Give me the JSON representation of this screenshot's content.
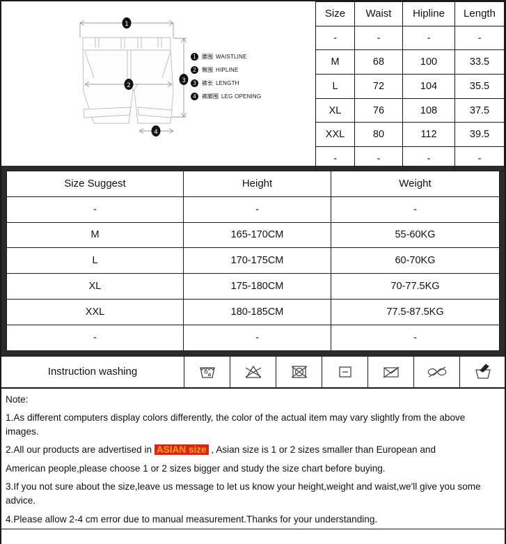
{
  "diagram": {
    "alt": "mens shorts technical drawing with measurement arrows",
    "markers": [
      "1",
      "2",
      "3",
      "4"
    ],
    "legend": [
      {
        "num": "1",
        "cn": "腰围",
        "en": "WAISTLINE"
      },
      {
        "num": "2",
        "cn": "臀围",
        "en": "HIPLINE"
      },
      {
        "num": "3",
        "cn": "裤长",
        "en": "LENGTH"
      },
      {
        "num": "4",
        "cn": "裤脚围",
        "en": "LEG OPENING"
      }
    ]
  },
  "size_table": {
    "headers": [
      "Size",
      "Waist",
      "Hipline",
      "Length"
    ],
    "rows": [
      [
        "-",
        "-",
        "-",
        "-"
      ],
      [
        "M",
        "68",
        "100",
        "33.5"
      ],
      [
        "L",
        "72",
        "104",
        "35.5"
      ],
      [
        "XL",
        "76",
        "108",
        "37.5"
      ],
      [
        "XXL",
        "80",
        "112",
        "39.5"
      ],
      [
        "-",
        "-",
        "-",
        "-"
      ]
    ]
  },
  "suggest_table": {
    "headers": [
      "Size Suggest",
      "Height",
      "Weight"
    ],
    "rows": [
      [
        "-",
        "-",
        "-"
      ],
      [
        "M",
        "165-170CM",
        "55-60KG"
      ],
      [
        "L",
        "170-175CM",
        "60-70KG"
      ],
      [
        "XL",
        "175-180CM",
        "70-77.5KG"
      ],
      [
        "XXL",
        "180-185CM",
        "77.5-87.5KG"
      ],
      [
        "-",
        "-",
        "-"
      ]
    ]
  },
  "washing": {
    "label": "Instruction washing",
    "icons": [
      "machine-wash-icon",
      "do-not-bleach-icon",
      "do-not-tumble-dry-icon",
      "dry-flat-icon",
      "do-not-drip-dry-icon",
      "do-not-wring-icon",
      "hand-wash-icon"
    ]
  },
  "note": {
    "title": "Note:",
    "line1a": "1.As different computers display colors differently, the color of the actual item may vary slightly from the above images.",
    "line2a": "2.All our products are advertised in ",
    "highlight": "ASIAN size",
    "line2b": " , Asian size is 1 or 2 sizes smaller than European and",
    "line2c": "American people,please choose 1 or 2 sizes bigger and study the size chart before buying.",
    "line3": "3.If you not sure about the size,leave us message to let us know your height,weight and waist,we'll give you some advice.",
    "line4": "4.Please allow 2-4 cm error due to manual measurement.Thanks for your understanding."
  },
  "colors": {
    "highlight_bg": "#d8251c",
    "highlight_text": "#ffa400",
    "band": "#2b2b2b"
  }
}
